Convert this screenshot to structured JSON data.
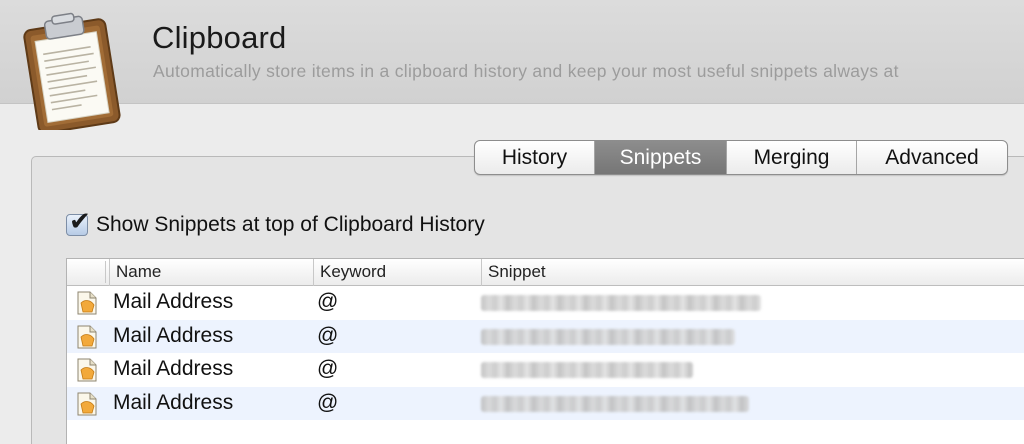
{
  "header": {
    "title": "Clipboard",
    "subtitle": "Automatically store items in a clipboard history and keep your most useful snippets always at"
  },
  "tabs": [
    {
      "label": "History",
      "selected": false
    },
    {
      "label": "Snippets",
      "selected": true
    },
    {
      "label": "Merging",
      "selected": false
    },
    {
      "label": "Advanced",
      "selected": false
    }
  ],
  "option": {
    "label": "Show Snippets at top of Clipboard History",
    "checked": true
  },
  "table": {
    "columns": [
      "Name",
      "Keyword",
      "Snippet"
    ],
    "rows": [
      {
        "name": "Mail Address",
        "keyword": "@"
      },
      {
        "name": "Mail Address",
        "keyword": "@"
      },
      {
        "name": "Mail Address",
        "keyword": "@"
      },
      {
        "name": "Mail Address",
        "keyword": "@"
      }
    ]
  },
  "colors": {
    "selected_tab": "#7f7f7f",
    "alt_row": "#edf3fe",
    "header_bg": "#d6d6d6"
  },
  "icons": {
    "app": "clipboard-icon",
    "row": "snippet-document-icon"
  }
}
